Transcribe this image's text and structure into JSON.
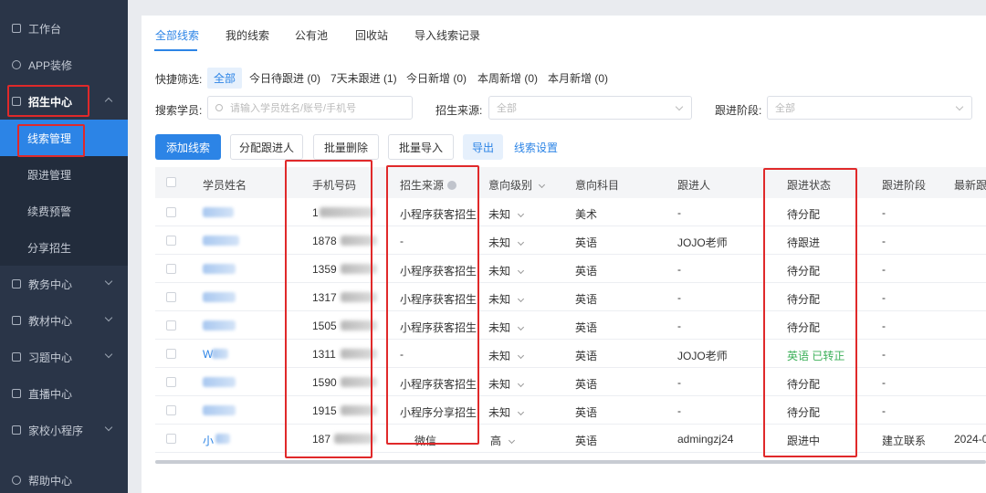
{
  "sidebar": {
    "items": [
      {
        "label": "工作台",
        "icon": "home-icon"
      },
      {
        "label": "APP装修",
        "icon": "palette-icon"
      },
      {
        "label": "招生中心",
        "icon": "megaphone-icon"
      },
      {
        "label": "教务中心",
        "icon": "folder-icon"
      },
      {
        "label": "教材中心",
        "icon": "book-icon"
      },
      {
        "label": "习题中心",
        "icon": "exercise-icon"
      },
      {
        "label": "直播中心",
        "icon": "live-icon"
      },
      {
        "label": "家校小程序",
        "icon": "mini-program-icon"
      },
      {
        "label": "帮助中心",
        "icon": "help-icon"
      }
    ],
    "sub_items": [
      {
        "label": "线索管理"
      },
      {
        "label": "跟进管理"
      },
      {
        "label": "续费预警"
      },
      {
        "label": "分享招生"
      }
    ]
  },
  "tabs": [
    "全部线索",
    "我的线索",
    "公有池",
    "回收站",
    "导入线索记录"
  ],
  "quick_filter": {
    "label": "快捷筛选:",
    "options": [
      "全部",
      "今日待跟进 (0)",
      "7天未跟进 (1)",
      "今日新增 (0)",
      "本周新增 (0)",
      "本月新增 (0)"
    ]
  },
  "search": {
    "student_label": "搜索学员:",
    "student_placeholder": "请输入学员姓名/账号/手机号",
    "source_label": "招生来源:",
    "source_value": "全部",
    "stage_label": "跟进阶段:",
    "stage_value": "全部"
  },
  "toolbar": {
    "add": "添加线索",
    "assign": "分配跟进人",
    "batch_delete": "批量删除",
    "batch_import": "批量导入",
    "export": "导出",
    "settings": "线索设置"
  },
  "table": {
    "headers": [
      "学员姓名",
      "手机号码",
      "招生来源",
      "意向级别",
      "意向科目",
      "跟进人",
      "跟进状态",
      "跟进阶段",
      "最新跟"
    ],
    "rows": [
      {
        "name": "",
        "phone": "1",
        "source": "小程序获客招生",
        "level": "未知",
        "subject": "美术",
        "owner": "-",
        "status": "待分配",
        "status_extra": "",
        "stage": "-",
        "latest": ""
      },
      {
        "name": "",
        "phone": "1878",
        "source": "-",
        "level": "未知",
        "subject": "英语",
        "owner": "JOJO老师",
        "status": "待跟进",
        "status_extra": "",
        "stage": "-",
        "latest": ""
      },
      {
        "name": "",
        "phone": "1359",
        "source": "小程序获客招生",
        "level": "未知",
        "subject": "英语",
        "owner": "-",
        "status": "待分配",
        "status_extra": "",
        "stage": "-",
        "latest": ""
      },
      {
        "name": "",
        "phone": "1317",
        "source": "小程序获客招生",
        "level": "未知",
        "subject": "英语",
        "owner": "-",
        "status": "待分配",
        "status_extra": "",
        "stage": "-",
        "latest": ""
      },
      {
        "name": "",
        "phone": "1505",
        "source": "小程序获客招生",
        "level": "未知",
        "subject": "英语",
        "owner": "-",
        "status": "待分配",
        "status_extra": "",
        "stage": "-",
        "latest": ""
      },
      {
        "name": "W",
        "phone": "1311",
        "source": "-",
        "level": "未知",
        "subject": "英语",
        "owner": "JOJO老师",
        "status": "英语",
        "status_extra": "已转正",
        "stage": "-",
        "latest": ""
      },
      {
        "name": "",
        "phone": "1590",
        "source": "小程序获客招生",
        "level": "未知",
        "subject": "英语",
        "owner": "-",
        "status": "待分配",
        "status_extra": "",
        "stage": "-",
        "latest": ""
      },
      {
        "name": "",
        "phone": "1915",
        "source": "小程序分享招生",
        "level": "未知",
        "subject": "英语",
        "owner": "-",
        "status": "待分配",
        "status_extra": "",
        "stage": "-",
        "latest": ""
      },
      {
        "name": "小",
        "phone": "187",
        "source": "微信",
        "level": "高",
        "subject": "英语",
        "owner": "admingzj24",
        "status": "跟进中",
        "status_extra": "",
        "stage": "建立联系",
        "latest": "2024-0"
      }
    ]
  },
  "colors": {
    "accent": "#2c84e6",
    "sidebar_bg": "#2a3548",
    "highlight": "#e0292a",
    "status_green": "#3db05a"
  }
}
